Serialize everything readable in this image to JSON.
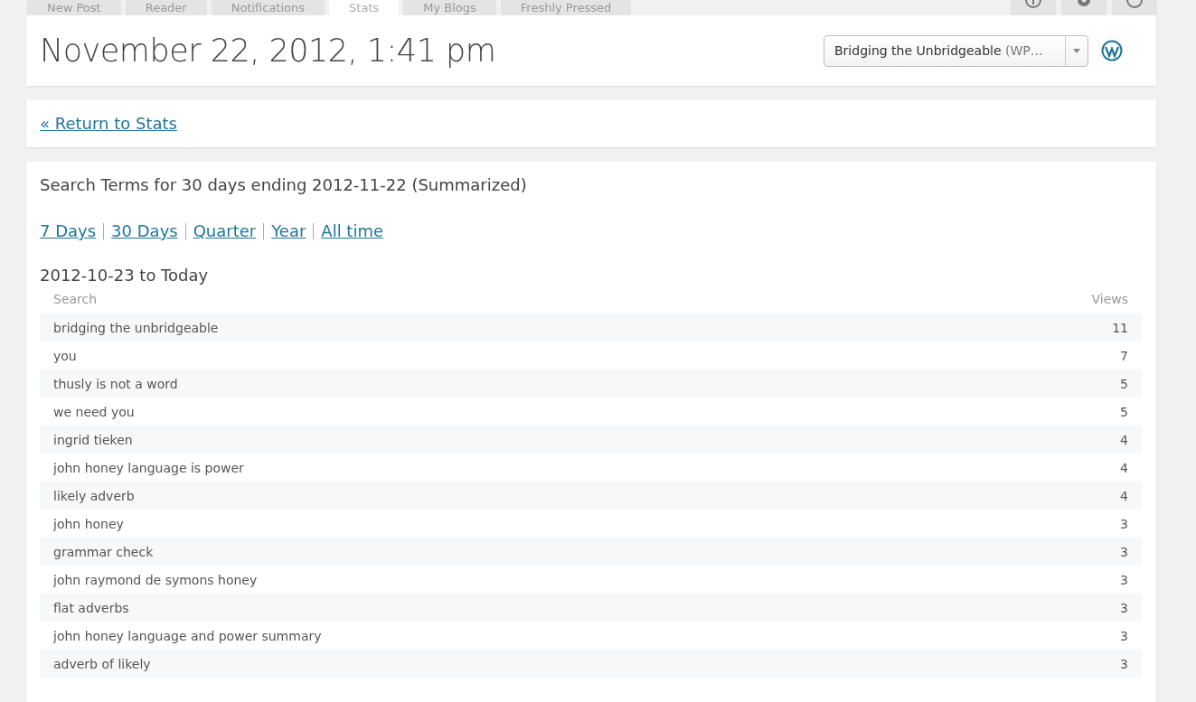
{
  "tabs": [
    {
      "label": "New Post",
      "selected": false
    },
    {
      "label": "Reader",
      "selected": false
    },
    {
      "label": "Notifications",
      "selected": false
    },
    {
      "label": "Stats",
      "selected": true
    },
    {
      "label": "My Blogs",
      "selected": false
    },
    {
      "label": "Freshly Pressed",
      "selected": false
    }
  ],
  "header": {
    "title": "November 22, 2012, 1:41 pm",
    "blog_select": "**Bridging the Unbridgeable** (WP…"
  },
  "return_link": "« Return to Stats",
  "report": {
    "heading": "Search Terms for 30 days ending 2012-11-22 (Summarized)",
    "periods": [
      "7 Days",
      "30 Days",
      "Quarter",
      "Year",
      "All time"
    ],
    "range": "2012-10-23 to Today",
    "columns": [
      "Search",
      "Views"
    ],
    "rows": [
      {
        "term": "bridging the unbridgeable",
        "views": "11"
      },
      {
        "term": "you",
        "views": "7"
      },
      {
        "term": "thusly is not a word",
        "views": "5"
      },
      {
        "term": "we need you",
        "views": "5"
      },
      {
        "term": "ingrid tieken",
        "views": "4"
      },
      {
        "term": "john honey language is power",
        "views": "4"
      },
      {
        "term": "likely adverb",
        "views": "4"
      },
      {
        "term": "john honey",
        "views": "3"
      },
      {
        "term": "grammar check",
        "views": "3"
      },
      {
        "term": "john raymond de symons honey",
        "views": "3"
      },
      {
        "term": "flat adverbs",
        "views": "3"
      },
      {
        "term": "john honey language and power summary",
        "views": "3"
      },
      {
        "term": "adverb of likely",
        "views": "3"
      }
    ]
  }
}
